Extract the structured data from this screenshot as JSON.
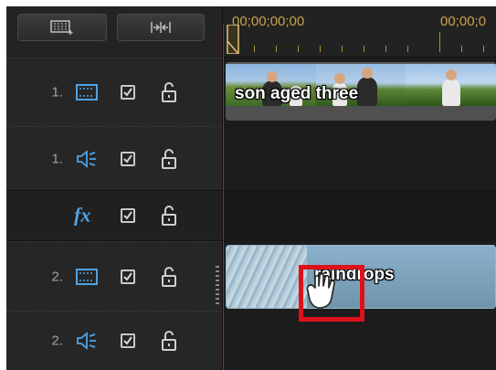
{
  "toolbar": {
    "insert_track_icon": "insert-track-icon",
    "fit_timeline_icon": "fit-timeline-icon"
  },
  "ruler": {
    "timecode_start": "00;00;00;00",
    "timecode_next": "00;00;0"
  },
  "tracks": [
    {
      "number": "1.",
      "type": "video",
      "icon": "video-track-icon"
    },
    {
      "number": "1.",
      "type": "audio",
      "icon": "audio-track-icon"
    },
    {
      "number": "",
      "type": "effect",
      "label": "fx"
    },
    {
      "number": "2.",
      "type": "video",
      "icon": "video-track-icon"
    },
    {
      "number": "2.",
      "type": "audio",
      "icon": "audio-track-icon"
    }
  ],
  "clips": {
    "video1": {
      "title": "son aged three"
    },
    "video2": {
      "title": "raindrops"
    }
  },
  "colors": {
    "accent_blue": "#4fa3e6",
    "timecode": "#c8a44a",
    "playhead": "#c01818",
    "highlight": "#e0101a"
  },
  "cursor": {
    "icon": "grab-hand-cursor-icon"
  }
}
